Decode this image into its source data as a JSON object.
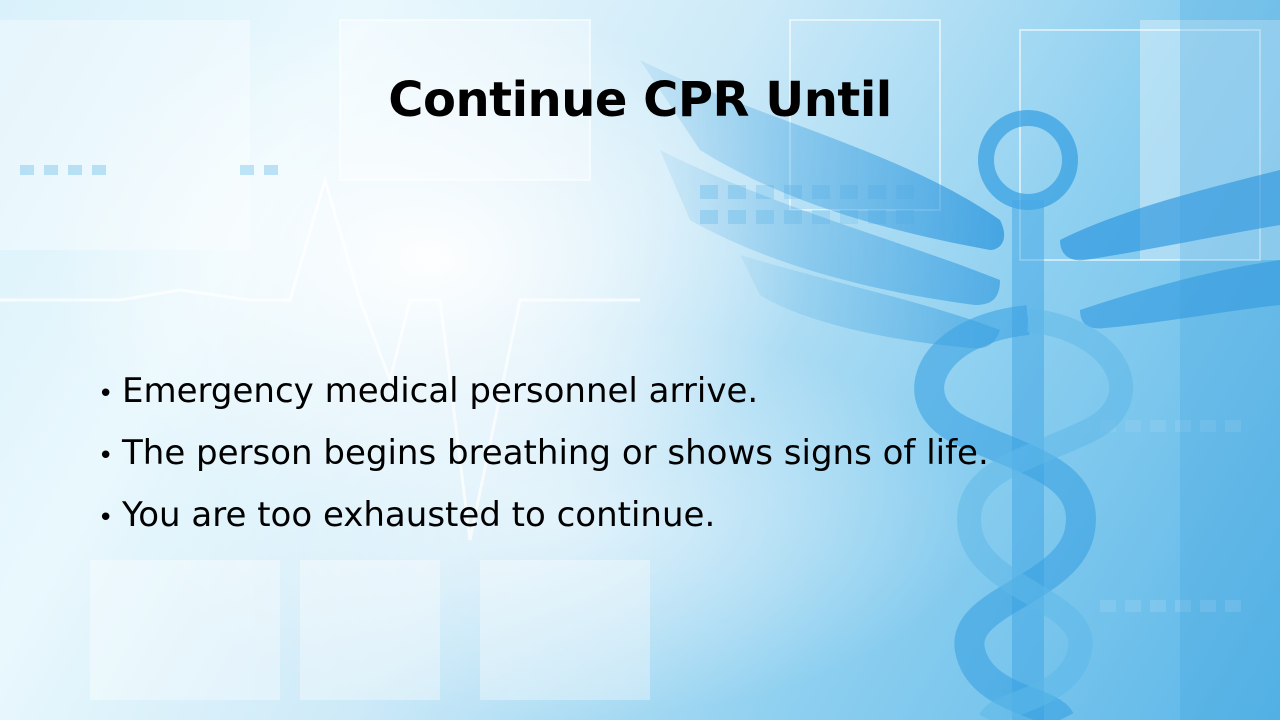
{
  "slide": {
    "title": "Continue CPR Until",
    "bullets": [
      "Emergency medical personnel arrive.",
      "The person begins breathing or shows signs of life.",
      "You are too exhausted to continue."
    ],
    "bullet_symbol": "•"
  },
  "background": {
    "description_icon": "caduceus-icon",
    "heartbeat_icon": "heartbeat-line-icon",
    "colors": {
      "light": "#e9f8fd",
      "mid": "#8fd0f0",
      "deep": "#3a9fdc"
    }
  }
}
